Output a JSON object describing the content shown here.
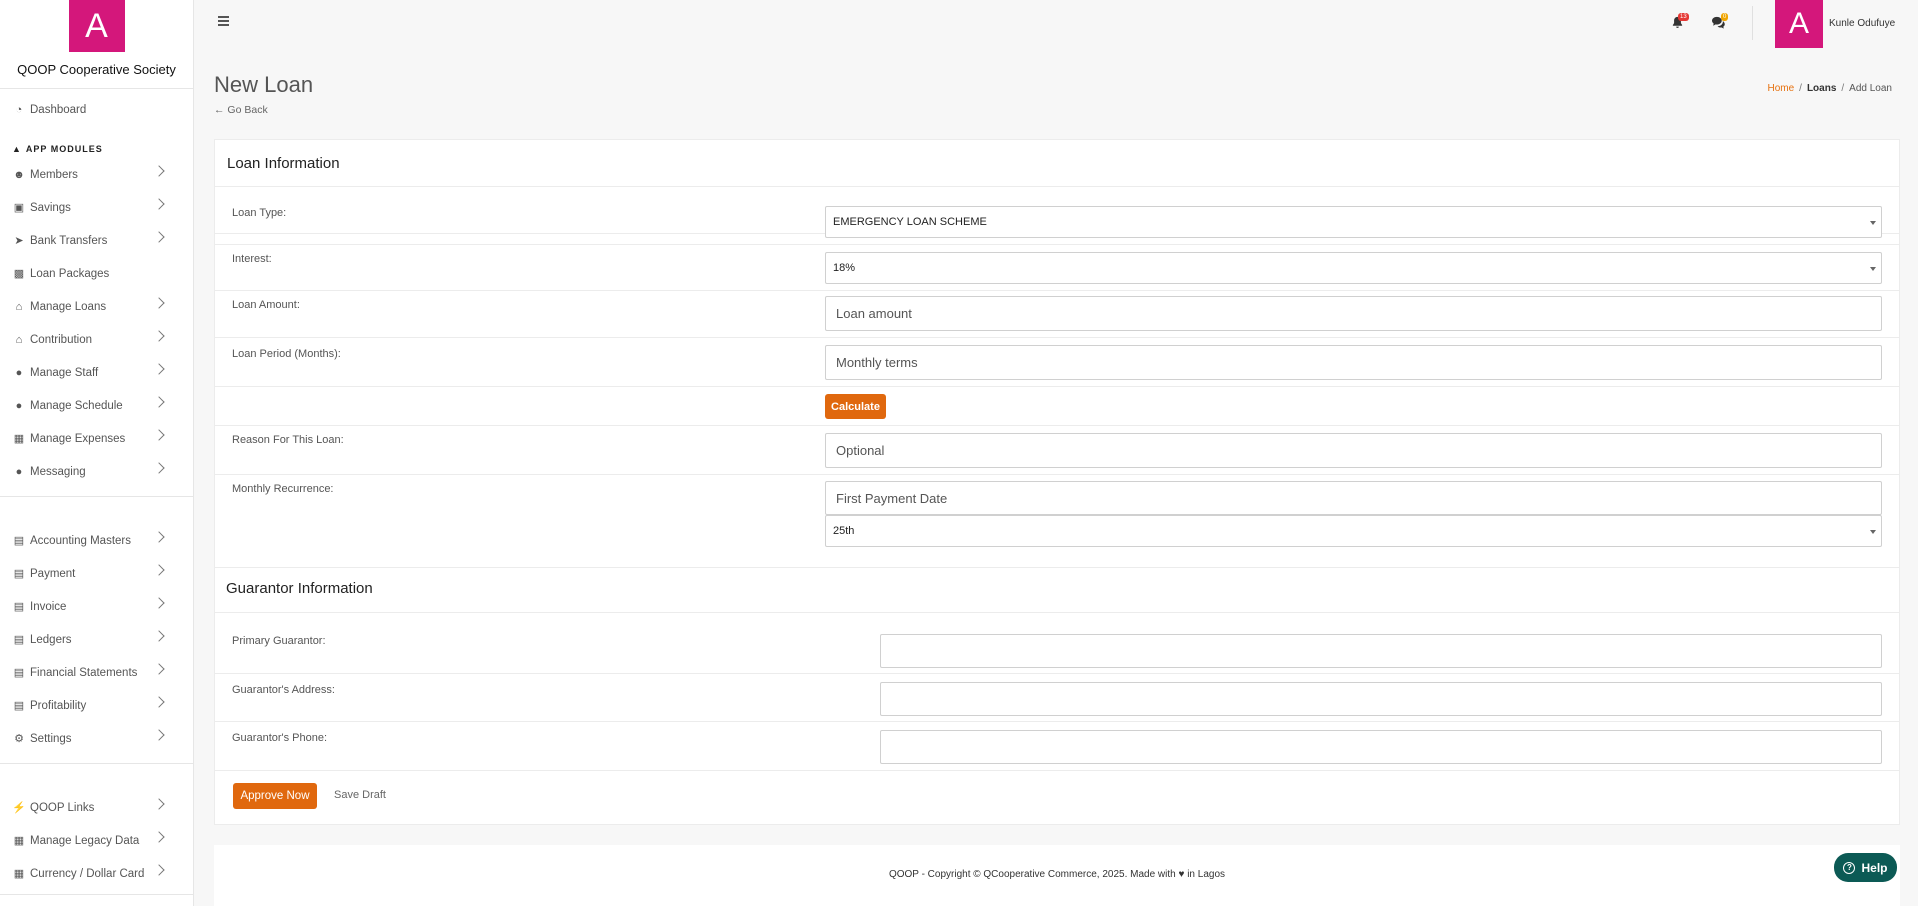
{
  "brand": {
    "logo_letter": "A",
    "org_name": "QOOP Cooperative Society",
    "accent": "#d4177b"
  },
  "sidebar": {
    "dashboard": "Dashboard",
    "section_title": "APP MODULES",
    "group1": [
      {
        "label": "Members",
        "icon": "users-icon"
      },
      {
        "label": "Savings",
        "icon": "money-icon"
      },
      {
        "label": "Bank Transfers",
        "icon": "paper-plane-icon"
      },
      {
        "label": "Loan Packages",
        "icon": "cart-icon"
      },
      {
        "label": "Manage Loans",
        "icon": "bank-icon"
      },
      {
        "label": "Contribution",
        "icon": "bank-icon"
      },
      {
        "label": "Manage Staff",
        "icon": "user-icon"
      },
      {
        "label": "Manage Schedule",
        "icon": "user-icon"
      },
      {
        "label": "Manage Expenses",
        "icon": "calculator-icon"
      },
      {
        "label": "Messaging",
        "icon": "comments-icon"
      }
    ],
    "group2": [
      {
        "label": "Accounting Masters",
        "icon": "chart-icon"
      },
      {
        "label": "Payment",
        "icon": "chart-icon"
      },
      {
        "label": "Invoice",
        "icon": "chart-icon"
      },
      {
        "label": "Ledgers",
        "icon": "chart-icon"
      },
      {
        "label": "Financial Statements",
        "icon": "chart-icon"
      },
      {
        "label": "Profitability",
        "icon": "chart-icon"
      },
      {
        "label": "Settings",
        "icon": "gear-icon"
      }
    ],
    "group3": [
      {
        "label": "QOOP Links",
        "icon": "bolt-icon"
      },
      {
        "label": "Manage Legacy Data",
        "icon": "calculator-icon"
      },
      {
        "label": "Currency / Dollar Card",
        "icon": "calculator-icon"
      }
    ]
  },
  "topbar": {
    "notif_count": "13",
    "msg_count": "0",
    "avatar_letter": "A",
    "user_name": "Kunle Odufuye"
  },
  "page": {
    "title": "New Loan",
    "go_back": "Go Back",
    "breadcrumb": {
      "home": "Home",
      "loans": "Loans",
      "current": "Add Loan"
    }
  },
  "loan_info": {
    "heading": "Loan Information",
    "loan_type_label": "Loan Type:",
    "loan_type_value": "EMERGENCY LOAN SCHEME",
    "interest_label": "Interest:",
    "interest_value": "18%",
    "amount_label": "Loan Amount:",
    "amount_placeholder": "Loan amount",
    "period_label": "Loan Period (Months):",
    "period_placeholder": "Monthly terms",
    "calculate": "Calculate",
    "reason_label": "Reason For This Loan:",
    "reason_placeholder": "Optional",
    "recurrence_label": "Monthly Recurrence:",
    "first_payment_placeholder": "First Payment Date",
    "recurrence_day": "25th"
  },
  "guarantor": {
    "heading": "Guarantor Information",
    "primary_label": "Primary Guarantor:",
    "address_label": "Guarantor's Address:",
    "phone_label": "Guarantor's Phone:"
  },
  "actions": {
    "approve": "Approve Now",
    "save_draft": "Save Draft"
  },
  "footer": {
    "text": "QOOP - Copyright © QCooperative Commerce, 2025. Made with ♥ in Lagos"
  },
  "help": {
    "label": "Help"
  },
  "colors": {
    "orange": "#e0680e",
    "help_bg": "#0c5a55"
  }
}
